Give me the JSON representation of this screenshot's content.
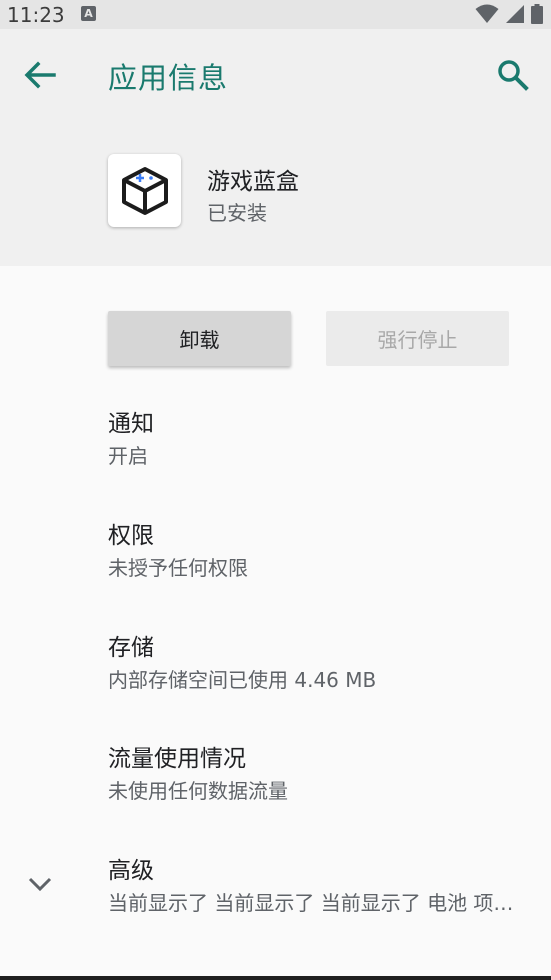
{
  "status_bar": {
    "time": "11:23",
    "notification_glyph": "A",
    "icons": [
      "wifi-icon",
      "signal-icon",
      "battery-icon"
    ]
  },
  "header": {
    "title": "应用信息",
    "back_icon": "arrow-left-icon",
    "search_icon": "search-icon",
    "accent_color": "#1a7a6e"
  },
  "app": {
    "name": "游戏蓝盒",
    "status": "已安装",
    "icon": "game-box-icon"
  },
  "buttons": {
    "uninstall": "卸载",
    "force_stop": "强行停止"
  },
  "preferences": [
    {
      "title": "通知",
      "summary": "开启"
    },
    {
      "title": "权限",
      "summary": "未授予任何权限"
    },
    {
      "title": "存储",
      "summary": "内部存储空间已使用 4.46 MB"
    },
    {
      "title": "流量使用情况",
      "summary": "未使用任何数据流量"
    },
    {
      "title": "高级",
      "summary": "当前显示了 当前显示了 当前显示了 电池 项…"
    }
  ]
}
